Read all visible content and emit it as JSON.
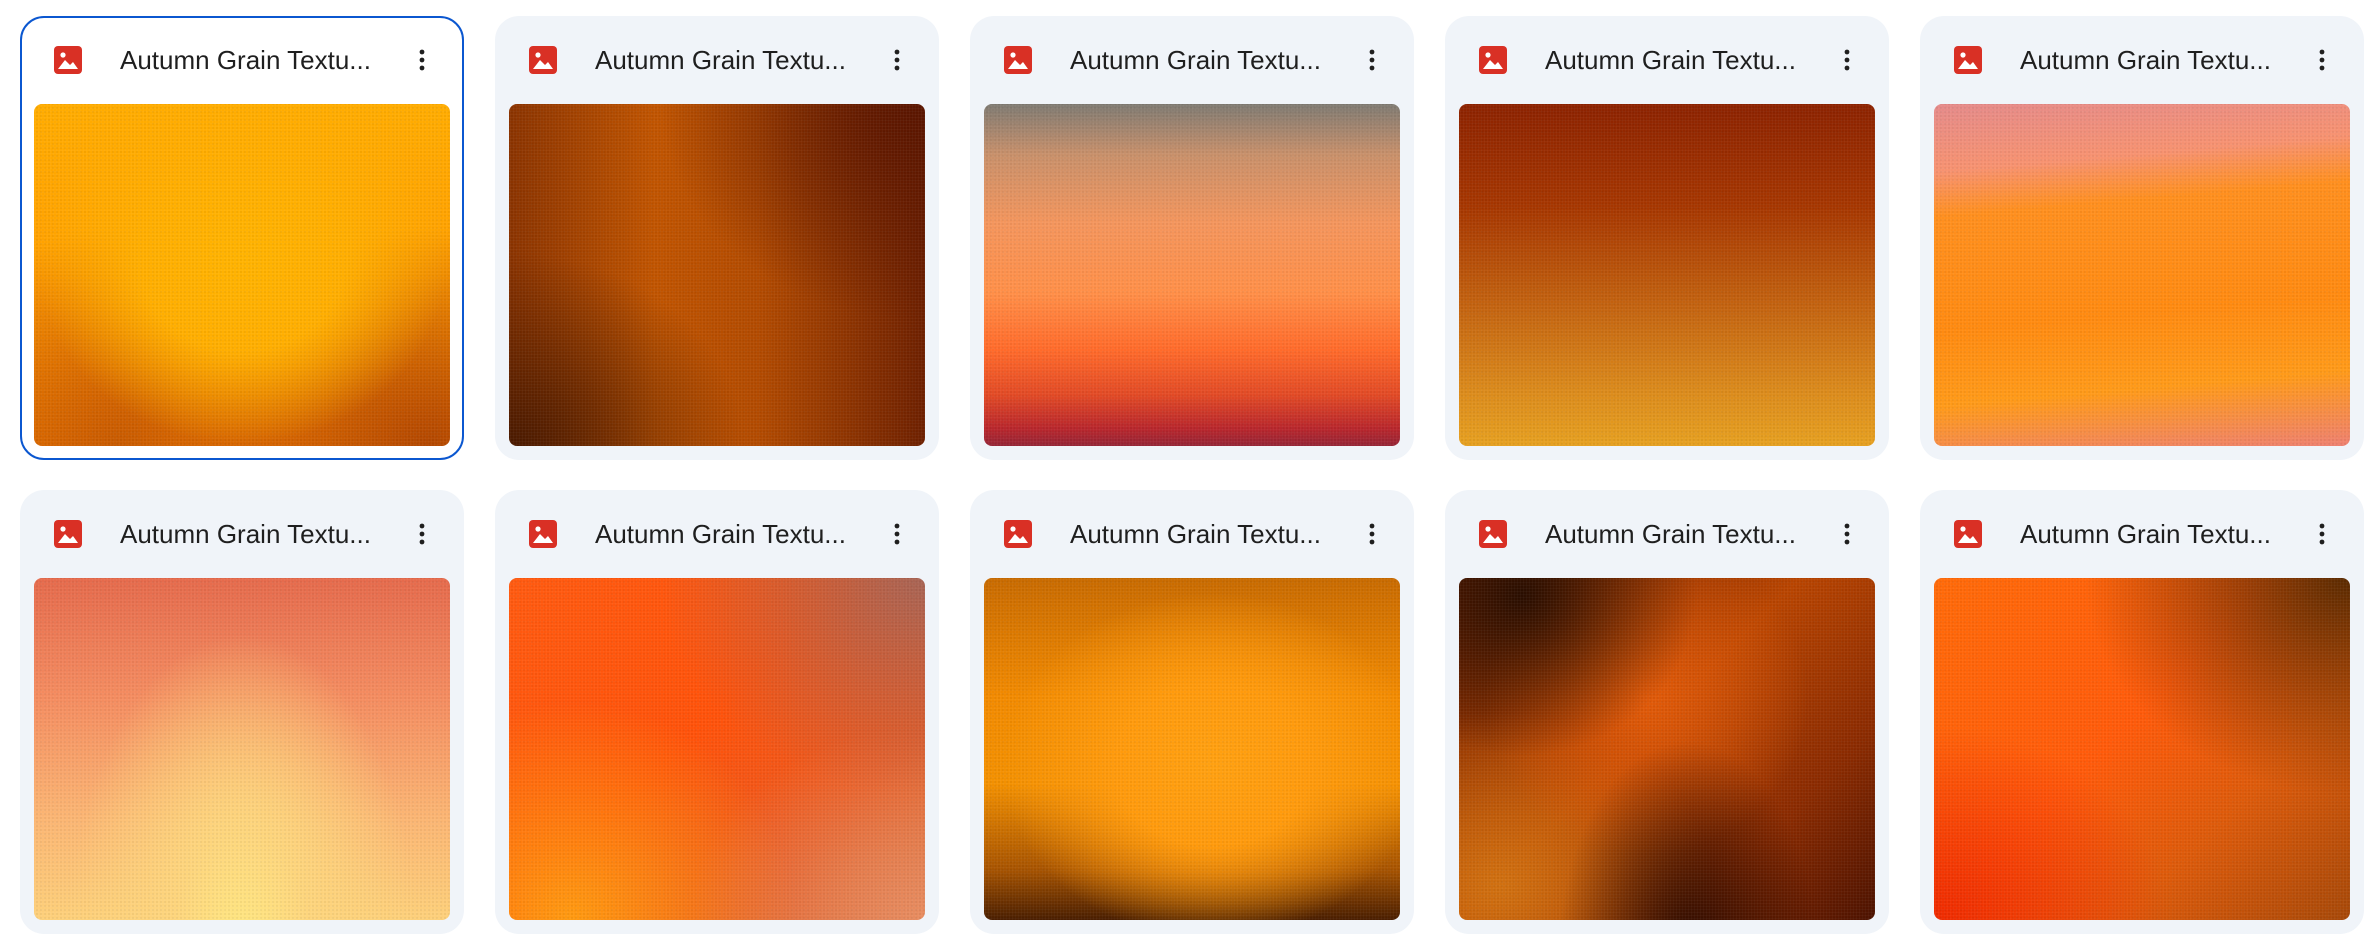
{
  "icon_color": "#d93025",
  "files": [
    {
      "title": "Autumn Grain Textu...",
      "icon": "image-icon",
      "selected": true
    },
    {
      "title": "Autumn Grain Textu...",
      "icon": "image-icon",
      "selected": false
    },
    {
      "title": "Autumn Grain Textu...",
      "icon": "image-icon",
      "selected": false
    },
    {
      "title": "Autumn Grain Textu...",
      "icon": "image-icon",
      "selected": false
    },
    {
      "title": "Autumn Grain Textu...",
      "icon": "image-icon",
      "selected": false
    },
    {
      "title": "Autumn Grain Textu...",
      "icon": "image-icon",
      "selected": false
    },
    {
      "title": "Autumn Grain Textu...",
      "icon": "image-icon",
      "selected": false
    },
    {
      "title": "Autumn Grain Textu...",
      "icon": "image-icon",
      "selected": false
    },
    {
      "title": "Autumn Grain Textu...",
      "icon": "image-icon",
      "selected": false
    },
    {
      "title": "Autumn Grain Textu...",
      "icon": "image-icon",
      "selected": false
    }
  ]
}
